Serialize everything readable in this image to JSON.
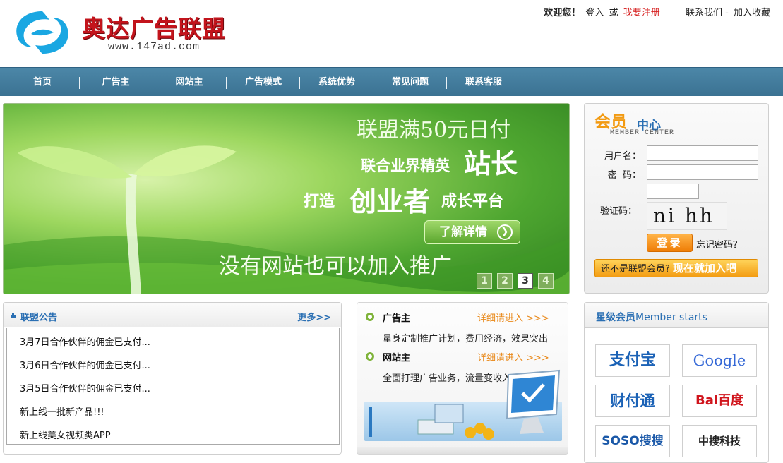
{
  "header": {
    "logo_title": "奥达广告联盟",
    "logo_url": "www.147ad.com",
    "welcome": "欢迎您！",
    "login": "登入",
    "or": "或",
    "register": "我要注册",
    "contact": "联系我们 -",
    "favorite": "加入收藏"
  },
  "nav": {
    "items": [
      "首页",
      "广告主",
      "网站主",
      "广告模式",
      "系统优势",
      "常见问题",
      "联系客服"
    ]
  },
  "banner": {
    "line1": "联盟满50元日付",
    "line2a": "联合业界精英",
    "line2b": "站长",
    "line3a": "打造",
    "line3b": "创业者",
    "line3c": "成长平台",
    "detail_button": "了解详情",
    "line4": "没有网站也可以加入推广",
    "pages": [
      "1",
      "2",
      "3",
      "4"
    ],
    "active_page": "3"
  },
  "member": {
    "title_part1": "会员",
    "title_part2": "中心",
    "subtitle": "MEMBER CENTER",
    "username_label": "用户名：",
    "password_label": "密  码：",
    "captcha_label": "验证码：",
    "captcha_text": "ni hh",
    "login_button": "登录",
    "forgot": "忘记密码？",
    "join_prompt": "还不是联盟会员?",
    "join_now": "现在就加入吧"
  },
  "notice": {
    "title": "联盟公告",
    "more": "更多>>",
    "items": [
      "3月7日合作伙伴的佣金已支付...",
      "3月6日合作伙伴的佣金已支付...",
      "3月5日合作伙伴的佣金已支付...",
      "新上线一批新产品!!!",
      "新上线美女视频类APP"
    ]
  },
  "center": {
    "advertiser_title": "广告主",
    "advertiser_link": "详细请进入 >>>",
    "advertiser_desc": "量身定制推广计划，费用经济，效果突出",
    "publisher_title": "网站主",
    "publisher_link": "详细请进入 >>>",
    "publisher_desc": "全面打理广告业务，流量变收入"
  },
  "stars": {
    "title_cn": "星级会员",
    "title_en": "Member starts",
    "logos": [
      "支付宝",
      "Google",
      "财付通",
      "Bai百度",
      "SOSO搜搜",
      "中搜科技"
    ]
  },
  "colors": {
    "nav_bg": "#3b7292",
    "brand_red": "#c3141c",
    "accent_orange": "#ef7d06",
    "link_blue": "#2a6fb3"
  }
}
